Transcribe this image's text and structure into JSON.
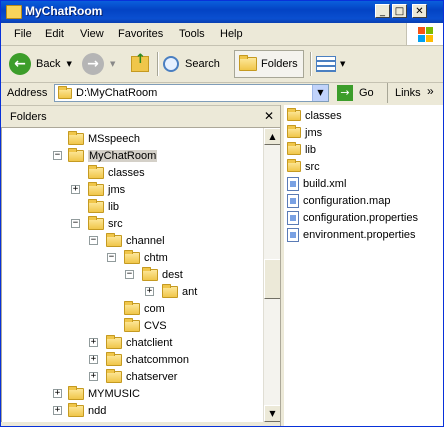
{
  "window": {
    "title": "MyChatRoom"
  },
  "title_buttons": {
    "minimize": "_",
    "maximize": "□",
    "close": "✕"
  },
  "menu": [
    "File",
    "Edit",
    "View",
    "Favorites",
    "Tools",
    "Help"
  ],
  "toolbar": {
    "back": "Back",
    "search": "Search",
    "folders": "Folders"
  },
  "address": {
    "label": "Address",
    "value": "D:\\MyChatRoom",
    "go": "Go",
    "links": "Links",
    "links_chevron": "»"
  },
  "folders_pane": {
    "title": "Folders",
    "close": "✕"
  },
  "tree": [
    {
      "label": "MSspeech",
      "expander": ""
    },
    {
      "label": "MyChatRoom",
      "expander": "−"
    },
    {
      "label": "classes",
      "expander": ""
    },
    {
      "label": "jms",
      "expander": "+"
    },
    {
      "label": "lib",
      "expander": ""
    },
    {
      "label": "src",
      "expander": "−"
    },
    {
      "label": "channel",
      "expander": "−"
    },
    {
      "label": "chtm",
      "expander": "−"
    },
    {
      "label": "dest",
      "expander": "−"
    },
    {
      "label": "ant",
      "expander": "+"
    },
    {
      "label": "com",
      "expander": ""
    },
    {
      "label": "CVS",
      "expander": ""
    },
    {
      "label": "chatclient",
      "expander": "+"
    },
    {
      "label": "chatcommon",
      "expander": "+"
    },
    {
      "label": "chatserver",
      "expander": "+"
    },
    {
      "label": "MYMUSIC",
      "expander": "+"
    },
    {
      "label": "ndd",
      "expander": "+"
    }
  ],
  "files": [
    {
      "name": "classes",
      "kind": "folder"
    },
    {
      "name": "jms",
      "kind": "folder"
    },
    {
      "name": "lib",
      "kind": "folder"
    },
    {
      "name": "src",
      "kind": "folder"
    },
    {
      "name": "build.xml",
      "kind": "file"
    },
    {
      "name": "configuration.map",
      "kind": "file"
    },
    {
      "name": "configuration.properties",
      "kind": "file"
    },
    {
      "name": "environment.properties",
      "kind": "file"
    }
  ]
}
